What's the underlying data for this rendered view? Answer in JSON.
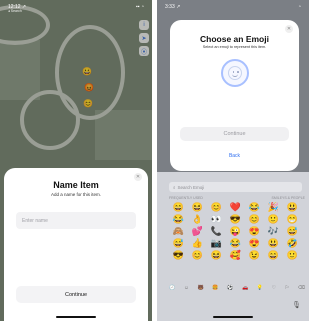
{
  "left_screen": {
    "status": {
      "time": "12:12 ↗",
      "subtitle": "◂ Search",
      "icons": "▪▪ ◔"
    },
    "map_pins": [
      "😀",
      "😡",
      "😊"
    ],
    "map_tools": [
      "i",
      "➤",
      "⦿"
    ],
    "sheet": {
      "title": "Name Item",
      "subtitle": "Add a name for this item.",
      "input_placeholder": "Enter name",
      "continue_label": "Continue",
      "close_glyph": "✕"
    }
  },
  "right_screen": {
    "status": {
      "time": "3:33 ↗",
      "icons": "◔"
    },
    "sheet": {
      "title": "Choose an Emoji",
      "subtitle": "Select an emoji to represent this item.",
      "continue_label": "Continue",
      "back_label": "Back",
      "close_glyph": "✕"
    },
    "keyboard": {
      "search_placeholder": "Search Emoji",
      "category_left": "Frequently Used",
      "category_right": "Smileys & People",
      "emojis": [
        "😄",
        "😆",
        "😊",
        "❤️",
        "😂",
        "🎉",
        "😃",
        "😂",
        "👌",
        "👀",
        "😎",
        "😊",
        "🙂",
        "😁",
        "🙈",
        "💕",
        "📞",
        "😜",
        "😍",
        "🎶",
        "😅",
        "😅",
        "👍",
        "📷",
        "😂",
        "😍",
        "😃",
        "🤣",
        "😎",
        "😊",
        "😆",
        "🥰",
        "😉",
        "😄",
        "🙂"
      ],
      "bottom_icons": [
        "🕘",
        "☺",
        "🐻",
        "🍔",
        "⚽",
        "🚗",
        "💡",
        "♡",
        "⚐",
        "⌫"
      ],
      "mic_icon": "🎙"
    }
  }
}
